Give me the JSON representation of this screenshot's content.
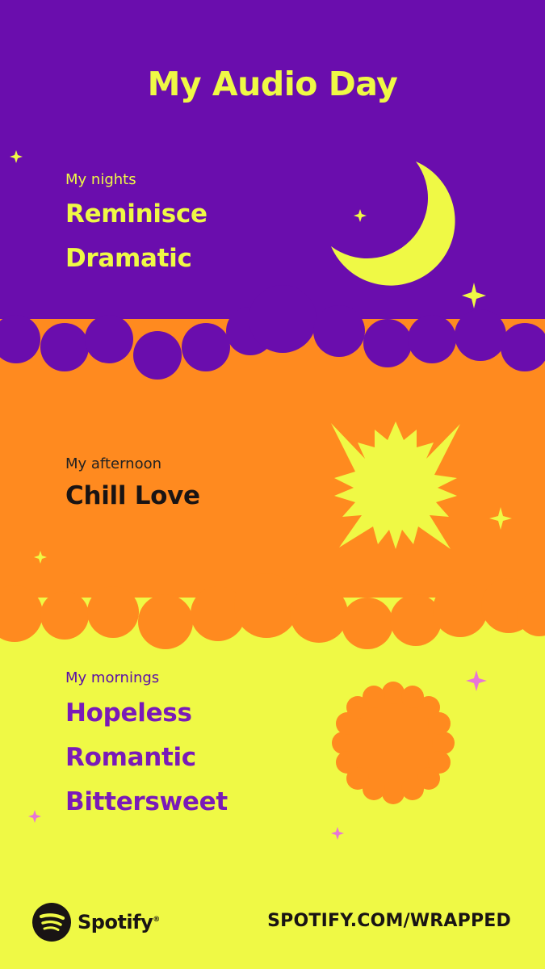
{
  "title": "My Audio Day",
  "nights": {
    "label": "My nights",
    "moods": [
      "Reminisce",
      "Dramatic"
    ]
  },
  "afternoon": {
    "label": "My afternoon",
    "moods": [
      "Chill Love"
    ]
  },
  "mornings": {
    "label": "My mornings",
    "moods": [
      "Hopeless",
      "Romantic",
      "Bittersweet"
    ]
  },
  "footer": {
    "brand": "Spotify",
    "registered": "®",
    "url": "SPOTIFY.COM/WRAPPED"
  },
  "colors": {
    "night": "#6A0DAD",
    "afternoon": "#FF8A1F",
    "morning": "#EFF945",
    "sparkle_pink": "#E876D6"
  },
  "icons": [
    "moon-icon",
    "sun-icon",
    "morning-sun-icon",
    "sparkle-icon",
    "spotify-logo-icon"
  ]
}
